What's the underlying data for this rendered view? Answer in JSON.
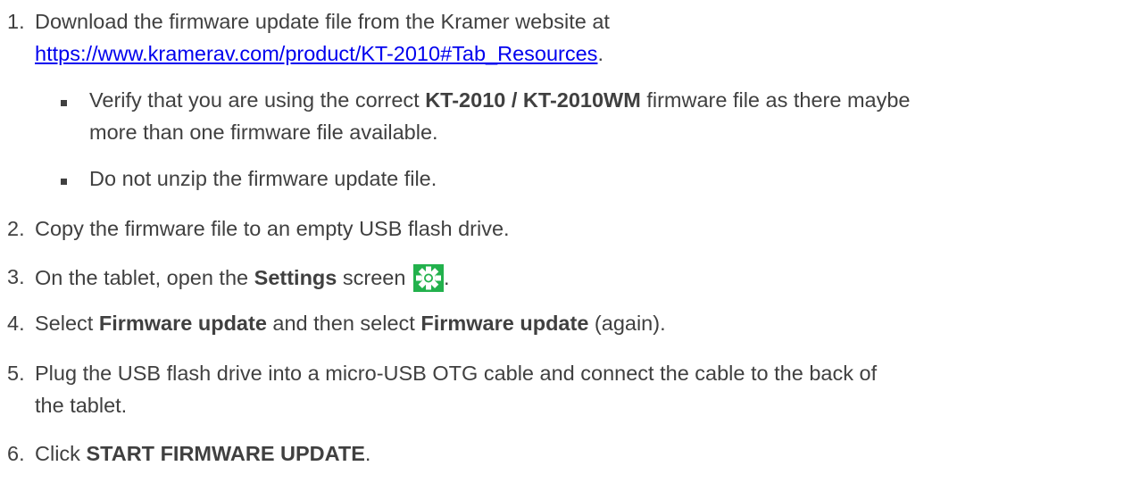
{
  "steps": [
    {
      "number": "1.",
      "text_before_link": "Download the firmware update file from the Kramer website at",
      "link": "https://www.kramerav.com/product/KT-2010#Tab_Resources",
      "link_suffix": ".",
      "bullets": [
        {
          "pre": "Verify that you are using the correct ",
          "bold": "KT-2010 / KT-2010WM",
          "post1": " firmware file as there maybe",
          "post2": "more than one firmware file available."
        },
        {
          "text": "Do not unzip the firmware update file."
        }
      ]
    },
    {
      "number": "2.",
      "text": "Copy the firmware file to an empty USB flash drive."
    },
    {
      "number": "3.",
      "pre": "On the tablet, open the ",
      "bold": "Settings",
      "post": " screen",
      "icon": "settings-gear-icon",
      "icon_color": "#22b14c",
      "suffix": "."
    },
    {
      "number": "4.",
      "pre": "Select ",
      "bold1": "Firmware update",
      "mid": " and then select ",
      "bold2": "Firmware update",
      "post": " (again)."
    },
    {
      "number": "5.",
      "line1": "Plug the USB flash drive into a micro-USB OTG cable and connect the cable to the back of",
      "line2": "the tablet."
    },
    {
      "number": "6.",
      "pre": "Click ",
      "bold": "START FIRMWARE UPDATE",
      "post": "."
    }
  ]
}
